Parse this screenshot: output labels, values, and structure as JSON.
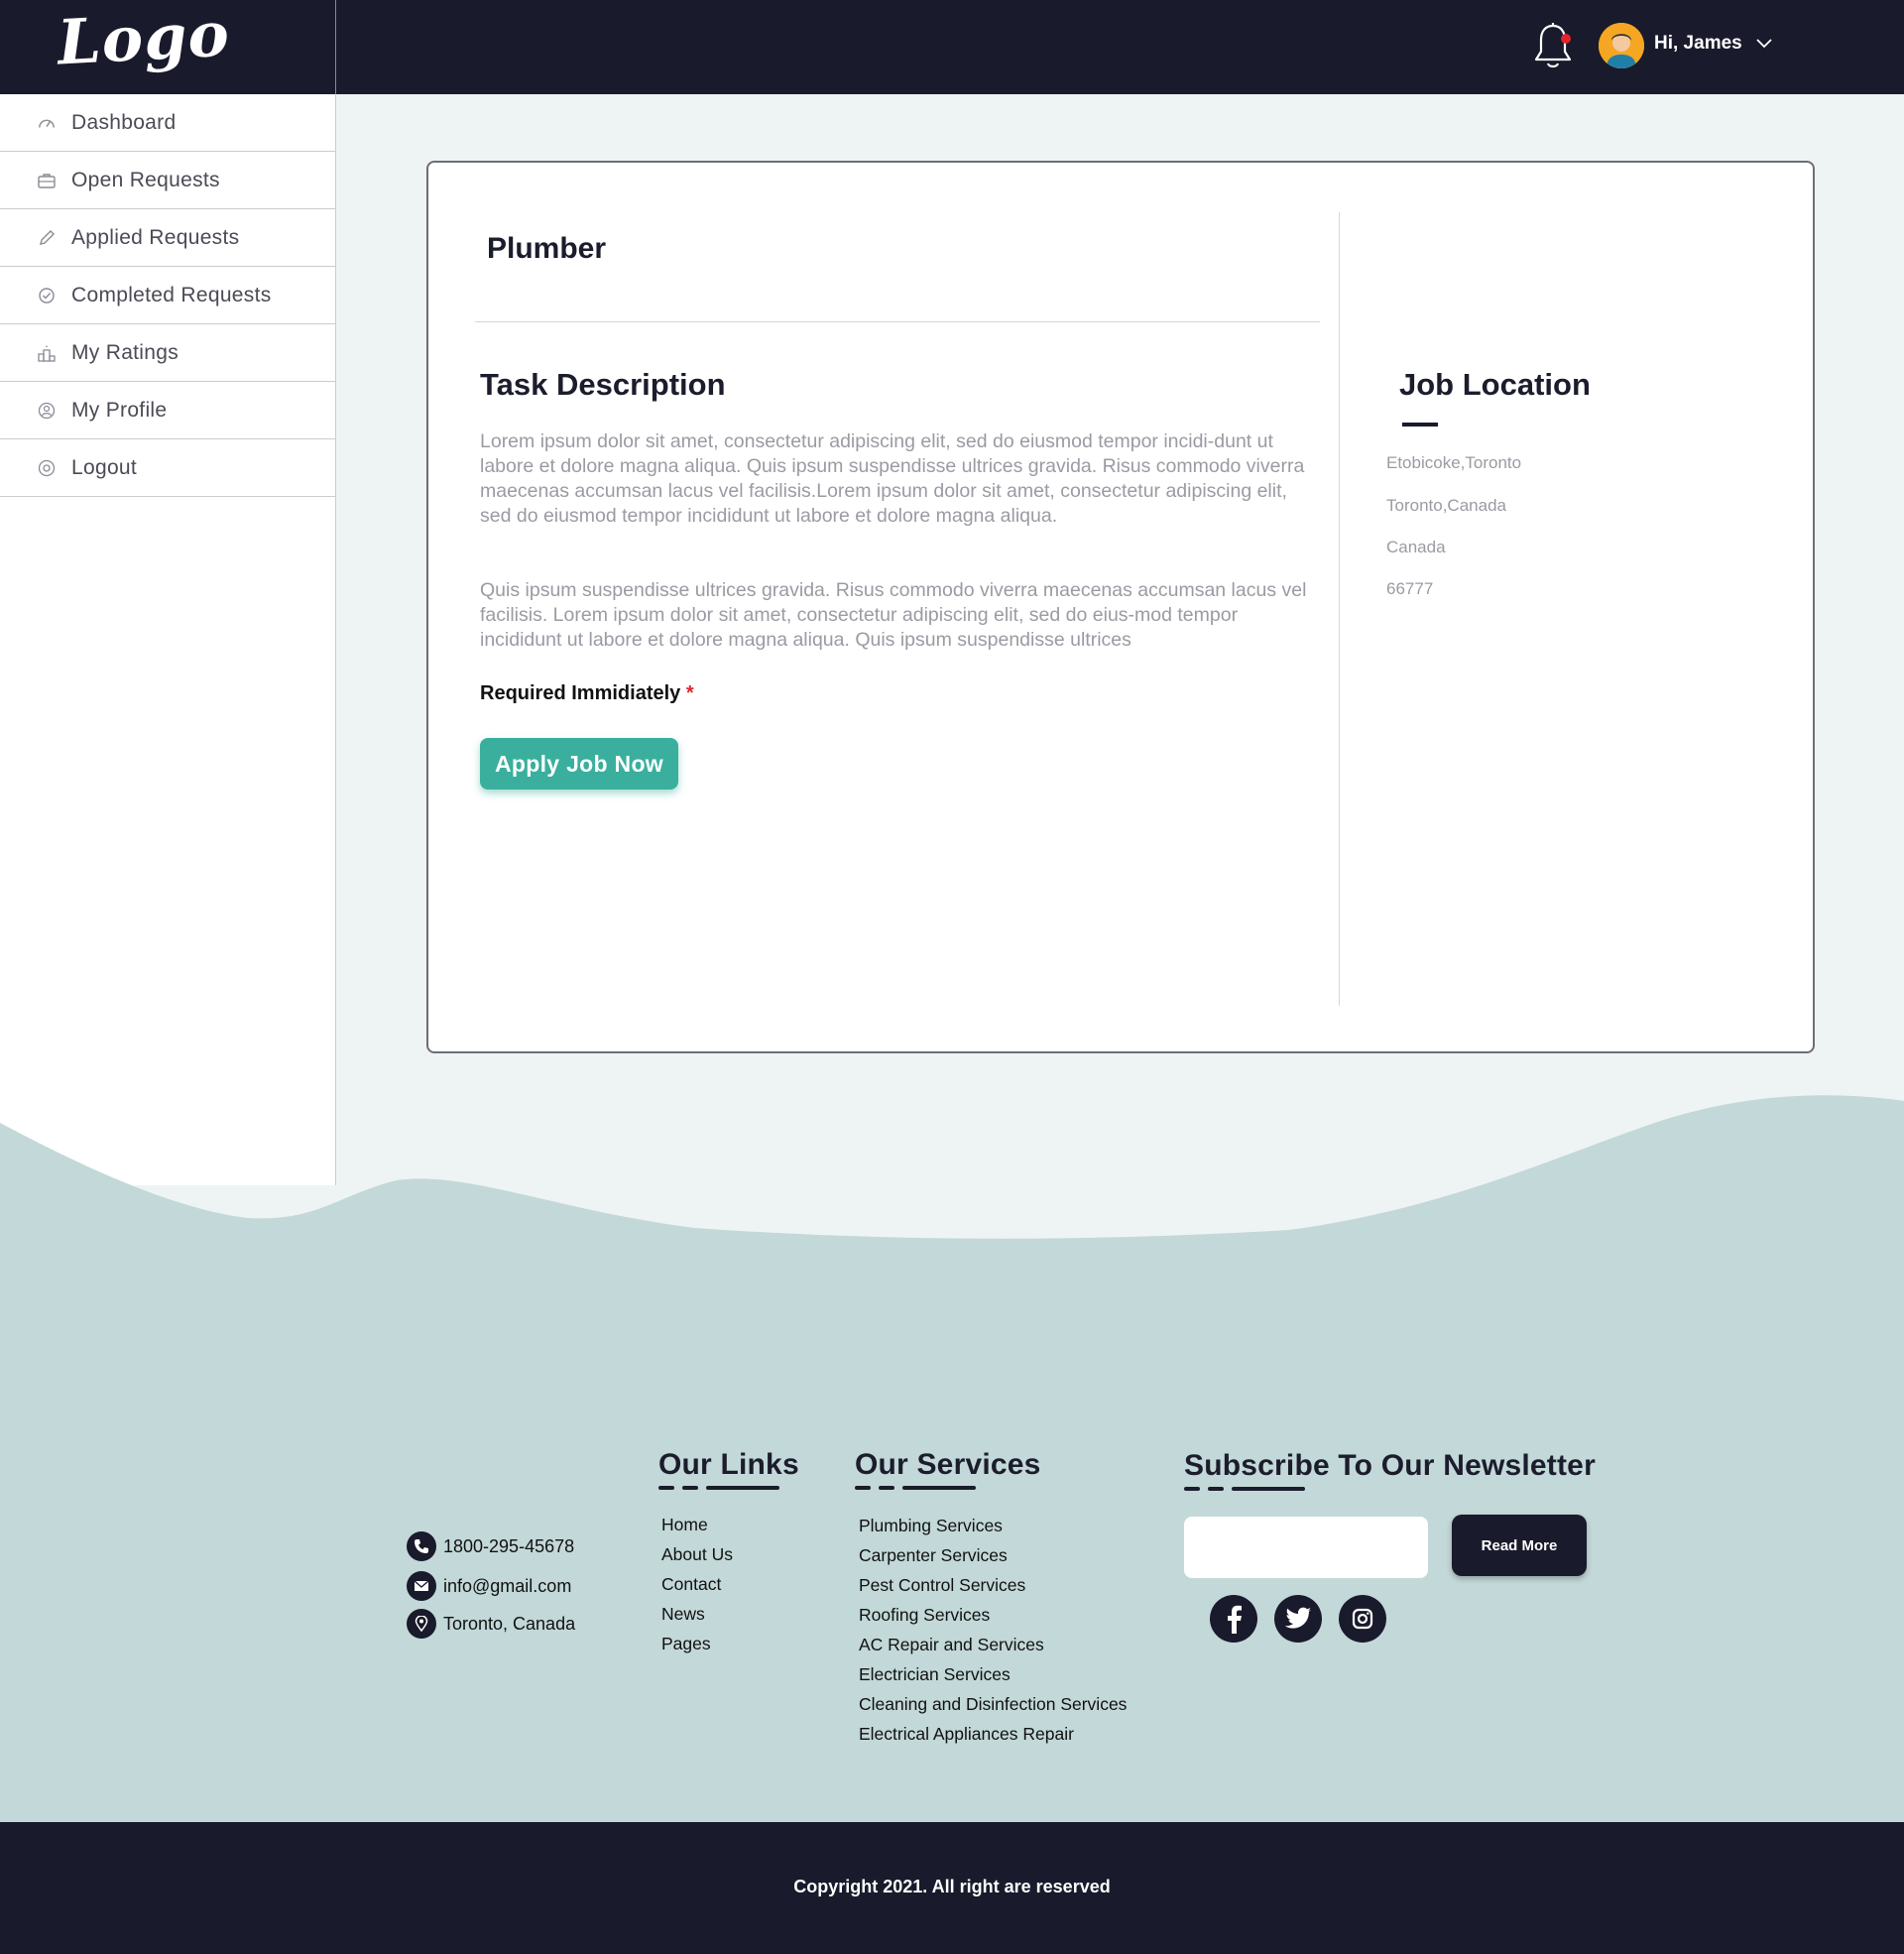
{
  "header": {
    "logo_text": "Logo",
    "greeting": "Hi, James",
    "notification_badge_color": "#e0242b"
  },
  "sidebar": {
    "items": [
      {
        "label": "Dashboard",
        "icon": "speedometer-icon"
      },
      {
        "label": "Open Requests",
        "icon": "briefcase-icon"
      },
      {
        "label": "Applied Requests",
        "icon": "pen-icon"
      },
      {
        "label": "Completed Requests",
        "icon": "check-circle-icon"
      },
      {
        "label": "My Ratings",
        "icon": "podium-icon"
      },
      {
        "label": "My Profile",
        "icon": "user-circle-icon"
      },
      {
        "label": "Logout",
        "icon": "power-icon"
      }
    ]
  },
  "job": {
    "title": "Plumber",
    "task_heading": "Task Description",
    "description_1": "Lorem ipsum dolor sit amet, consectetur adipiscing elit, sed do eiusmod tempor incidi-dunt ut labore et dolore magna aliqua. Quis ipsum suspendisse ultrices gravida. Risus commodo viverra maecenas accumsan lacus vel facilisis.Lorem ipsum dolor sit amet, consectetur adipiscing elit, sed do eiusmod tempor incididunt ut labore et dolore magna aliqua.",
    "description_2": "Quis ipsum suspendisse ultrices gravida. Risus commodo viverra maecenas accumsan lacus vel facilisis. Lorem ipsum dolor sit amet, consectetur adipiscing elit, sed do eius-mod tempor incididunt ut labore et dolore magna aliqua. Quis ipsum suspendisse ultrices",
    "required_label": "Required Immidiately",
    "required_mark": "*",
    "apply_button": "Apply Job Now",
    "accent_color": "#3aaf9d"
  },
  "location": {
    "heading": "Job Location",
    "lines": [
      "Etobicoke,Toronto",
      "Toronto,Canada",
      "Canada",
      "66777"
    ]
  },
  "footer": {
    "contact": {
      "phone": "1800-295-45678",
      "email": "info@gmail.com",
      "address": "Toronto, Canada"
    },
    "links_heading": "Our Links",
    "links": [
      "Home",
      "About Us",
      "Contact",
      "News",
      "Pages"
    ],
    "services_heading": "Our Services",
    "services": [
      "Plumbing Services",
      "Carpenter Services",
      "Pest Control Services",
      "Roofing Services",
      "AC Repair and Services",
      "Electrician Services",
      "Cleaning and Disinfection Services",
      "Electrical Appliances Repair"
    ],
    "newsletter_heading": "Subscribe To Our Newsletter",
    "newsletter_placeholder": "",
    "read_more": "Read More",
    "social": [
      "facebook-icon",
      "twitter-icon",
      "instagram-icon"
    ],
    "copyright": "Copyright 2021. All right are reserved"
  },
  "colors": {
    "navy": "#191a2b",
    "page_bg": "#eef4f3",
    "footer_bg": "#c3d8d8",
    "muted_text": "#9a9ba3"
  }
}
